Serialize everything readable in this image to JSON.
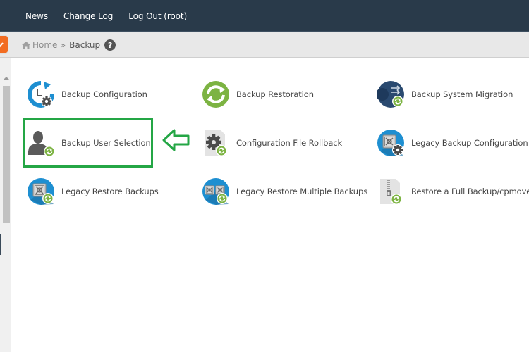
{
  "topbar": {
    "nav": [
      {
        "label": "News"
      },
      {
        "label": "Change Log"
      },
      {
        "label": "Log Out (root)"
      }
    ]
  },
  "breadcrumb": {
    "home": "Home",
    "separator": "»",
    "current": "Backup",
    "help_glyph": "?"
  },
  "items": [
    {
      "label": "Backup Configuration",
      "icon": "backup-configuration-icon"
    },
    {
      "label": "Backup Restoration",
      "icon": "backup-restoration-icon"
    },
    {
      "label": "Backup System Migration",
      "icon": "backup-system-migration-icon"
    },
    {
      "label": "Backup User Selection",
      "icon": "backup-user-selection-icon"
    },
    {
      "label": "Configuration File Rollback",
      "icon": "configuration-file-rollback-icon"
    },
    {
      "label": "Legacy Backup Configuration",
      "icon": "legacy-backup-configuration-icon"
    },
    {
      "label": "Legacy Restore Backups",
      "icon": "legacy-restore-backups-icon"
    },
    {
      "label": "Legacy Restore Multiple Backups",
      "icon": "legacy-restore-multiple-backups-icon"
    },
    {
      "label": "Restore a Full Backup/cpmove",
      "icon": "restore-full-backup-icon"
    }
  ],
  "annotation": {
    "highlighted_item": "Backup User Selection",
    "color": "#24a645"
  },
  "colors": {
    "topbar": "#293a4a",
    "accent_green": "#7cb342",
    "accent_blue": "#1e8fd1",
    "search_orange": "#f26c21"
  }
}
